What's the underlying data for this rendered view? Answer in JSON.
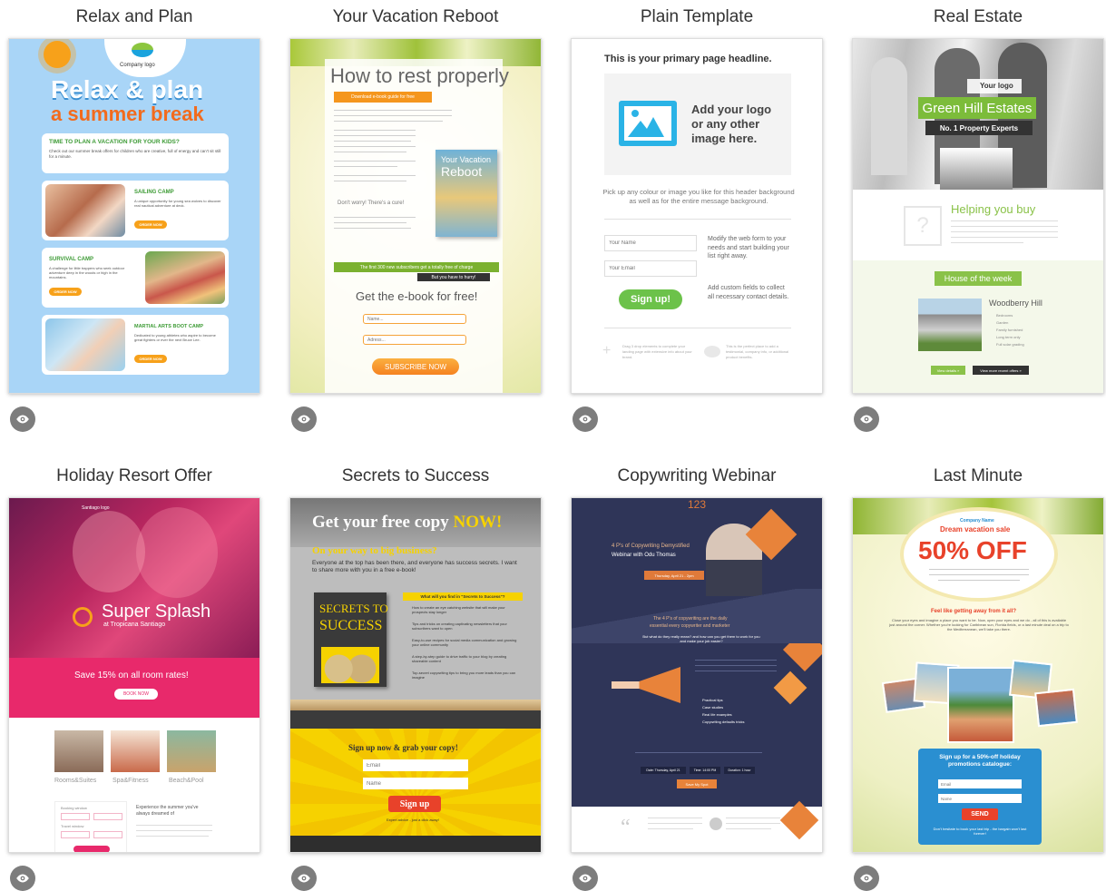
{
  "templates": [
    {
      "title": "Relax and Plan",
      "preview": {
        "company_logo": "Company logo",
        "headline_1": "Relax & plan",
        "headline_2": "a summer break",
        "question": "TIME TO PLAN A VACATION FOR YOUR KIDS?",
        "intro": "Check out our summer break offers for children who are creative, full of energy and can't sit still for a minute.",
        "sections": [
          {
            "title": "SAILING CAMP",
            "text": "A unique opportunity for young sea wolves to discover real nautical adventure at deck.",
            "button": "ORDER NOW"
          },
          {
            "title": "SURVIVAL CAMP",
            "text": "A challenge for little trappers who seek outdoor adventure deep in the woods or high in the mountains.",
            "button": "ORDER NOW"
          },
          {
            "title": "MARTIAL ARTS BOOT CAMP",
            "text": "Dedicated to young athletes who aspire to become great fighters or ever the next Bruce Lee.",
            "button": "ORDER NOW"
          }
        ]
      }
    },
    {
      "title": "Your Vacation Reboot",
      "preview": {
        "headline": "How to rest properly",
        "ribbon": "Download e-book guide for free",
        "book_title_1": "Your Vacation",
        "book_title_2": "Reboot",
        "note": "Don't worry! There's a cure!",
        "offer": "The first 300 new subscribers get a totally free of charge",
        "hurry": "But you have to hurry!",
        "cta_heading": "Get the e-book for free!",
        "name_placeholder": "Name...",
        "address_placeholder": "Adress...",
        "button": "SUBSCRIBE NOW"
      }
    },
    {
      "title": "Plain Template",
      "preview": {
        "headline": "This is your primary page headline.",
        "logo_text": "Add your logo or any other image here.",
        "description": "Pick up any colour or image you like for this header background as well as for the entire message background.",
        "name_placeholder": "Your Name",
        "email_placeholder": "Your Email",
        "form_note": "Modify the web form to your needs and start building your list right away.",
        "fields_note": "Add custom fields to collect all necessary contact details.",
        "button": "Sign up!",
        "footer_left": "Drag 3 drop elements to complete your landing page with extensive info about your brand.",
        "footer_right": "This is the perfect place to add a testimonial, company info, or additional product benefits."
      }
    },
    {
      "title": "Real Estate",
      "preview": {
        "logo": "Your logo",
        "brand": "Green Hill Estates",
        "tagline": "No. 1 Property Experts",
        "helping": "Helping you buy",
        "house_of_week": "House of the week",
        "property": "Woodberry Hill",
        "features": [
          "Bedrooms",
          "Garden",
          "Family furnished",
          "Long term only",
          "Full solar grading"
        ],
        "button_1": "View details »",
        "button_2": "View more recent offers »"
      }
    },
    {
      "title": "Holiday Resort Offer",
      "preview": {
        "logo": "Santiago logo",
        "headline": "Super Splash",
        "subline": "at Tropicana Santiago",
        "offer": "Save 15% on all room rates!",
        "button": "BOOK NOW",
        "categories": [
          "Rooms&Suites",
          "Spa&Fitness",
          "Beach&Pool"
        ],
        "booking_label": "Booking window",
        "travel_label": "Travel window",
        "experience": "Experience the summer you've always dreamed of"
      }
    },
    {
      "title": "Secrets to Success",
      "preview": {
        "headline_1": "Get your free copy ",
        "headline_2": "NOW!",
        "subheadline": "On your way to big business?",
        "intro": "Everyone at the top has been there, and everyone has success secrets. I want to share more with you in a free e-book!",
        "book_1": "SECRETS TO",
        "book_2": "SUCCESS",
        "list_title": "What will you find in \"Secrets to Success\"?",
        "list": [
          "How to create an eye catching website that will make your prospects stay longer",
          "Tips and tricks on creating captivating newsletters that your subscribers want to open",
          "Easy-to-use recipes for social media communication and growing your online community",
          "A step-by-step guide to drive traffic to your blog by creating shareable content",
          "Top-secret copywriting tips to bring you more leads than you can imagine"
        ],
        "signup_heading": "Sign up now & grab your copy!",
        "email_placeholder": "Email",
        "name_placeholder": "Name",
        "button": "Sign up",
        "footnote": "Expert advice - just a click away!"
      }
    },
    {
      "title": "Copywriting Webinar",
      "preview": {
        "number": "123",
        "heading_1": "4 P's of Copywriting Demystified",
        "heading_2": "Webinar with Odu Thomas",
        "date_badge": "Thursday, April 21 - 2pm",
        "middle_1": "The 4 P's of copywriting are the daily",
        "middle_2": "essential every copywriter and marketer",
        "question": "But what do they really mean? and how can you get them to work for you and make your job easier?",
        "topics": [
          "Practical tips",
          "Case studies",
          "Real life examples",
          "Copywriting defaults tricks"
        ],
        "date_1": "Date: Thursday, April 21",
        "date_2": "Time: 14:00 PM",
        "date_3": "Duration: 1 hour",
        "button": "Save My Spot"
      }
    },
    {
      "title": "Last Minute",
      "preview": {
        "company": "Company Name",
        "sale": "Dream vacation sale",
        "discount": "50% OFF",
        "question": "Feel like getting away from it all?",
        "body": "Close your eyes and imagine a place you want to be. Now, open your eyes and we do - all of this is available just around the corner. Whether you're looking for Caribbean sun, Florida fields, or a last minute deal on a trip to the Mediterranean, we'll take you there.",
        "signup_heading": "Sign up for a 50%-off holiday promotions catalogue:",
        "email_placeholder": "Email",
        "name_placeholder": "Name",
        "button": "SEND",
        "footnote": "Don't hesitate to book your last trip - the bargain won't last forever!"
      }
    }
  ],
  "icons": {
    "preview": "eye-icon"
  },
  "colors": {
    "preview_button": "#7d7d7d",
    "title_text": "#333333"
  }
}
